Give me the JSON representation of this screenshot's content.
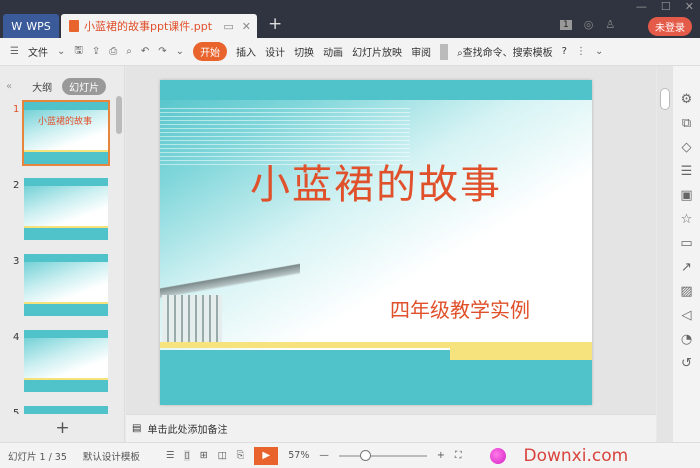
{
  "titlebar": {
    "wps_tab": "WPS",
    "doc_tab": "小蓝裙的故事ppt课件.ppt",
    "new_tab": "+",
    "badge": "1",
    "login": "未登录"
  },
  "toolbar": {
    "file": "文件",
    "tabs": [
      "开始",
      "插入",
      "设计",
      "切换",
      "动画",
      "幻灯片放映",
      "审阅"
    ],
    "search": "查找命令、搜索模板",
    "help": "?"
  },
  "left_panel": {
    "tab_outline": "大纲",
    "tab_slides": "幻灯片",
    "selected": 1,
    "thumbs": [
      {
        "num": "1",
        "title": "小蓝裙的故事"
      },
      {
        "num": "2"
      },
      {
        "num": "3"
      },
      {
        "num": "4"
      },
      {
        "num": "5"
      }
    ],
    "add": "+"
  },
  "slide": {
    "title": "小蓝裙的故事",
    "subtitle": "四年级教学实例"
  },
  "notes": {
    "placeholder": "单击此处添加备注"
  },
  "status": {
    "slide_counter": "幻灯片 1 / 35",
    "template": "默认设计模板",
    "zoom": "57%",
    "zoom_fraction": 0.3,
    "watermark": "Downxi.com"
  },
  "colors": {
    "accent": "#e8642c",
    "title_red": "#e0502a",
    "teal": "#4fc3c9",
    "titlebar": "#2f3440"
  }
}
